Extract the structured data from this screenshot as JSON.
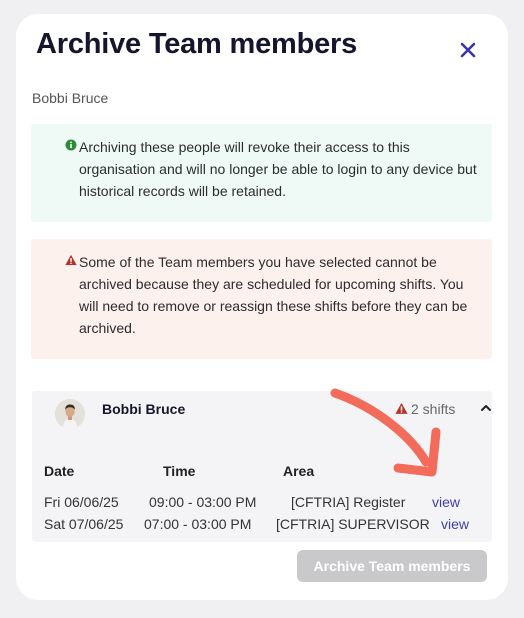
{
  "modal": {
    "title": "Archive Team members",
    "subtitle": "Bobbi Bruce",
    "close_icon": "close-icon"
  },
  "info_alert": {
    "icon": "info-icon",
    "color": "#2e8b3a",
    "text": "Archiving these people will revoke their access to this organisation and will no longer be able to login to any device but historical records will be retained."
  },
  "warning_alert": {
    "icon": "warning-icon",
    "color": "#b2342a",
    "text": "Some of the Team members you have selected cannot be archived because they are scheduled for upcoming shifts. You will need to remove or reassign these shifts before they can be archived."
  },
  "member": {
    "name": "Bobbi Bruce",
    "shifts_label": "2 shifts",
    "columns": [
      "Date",
      "Time",
      "Area"
    ],
    "shifts": [
      {
        "date": "Fri 06/06/25",
        "time": "09:00 - 03:00 PM",
        "area": "[CFTRIA] Register",
        "action": "view"
      },
      {
        "date": "Sat 07/06/25",
        "time": "07:00 - 03:00 PM",
        "area": "[CFTRIA] SUPERVISOR",
        "action": "view"
      }
    ]
  },
  "footer": {
    "archive_button_label": "Archive Team members",
    "archive_button_disabled": true
  },
  "colors": {
    "accent": "#3f3fa6",
    "annotation_arrow": "#f26b5b"
  }
}
